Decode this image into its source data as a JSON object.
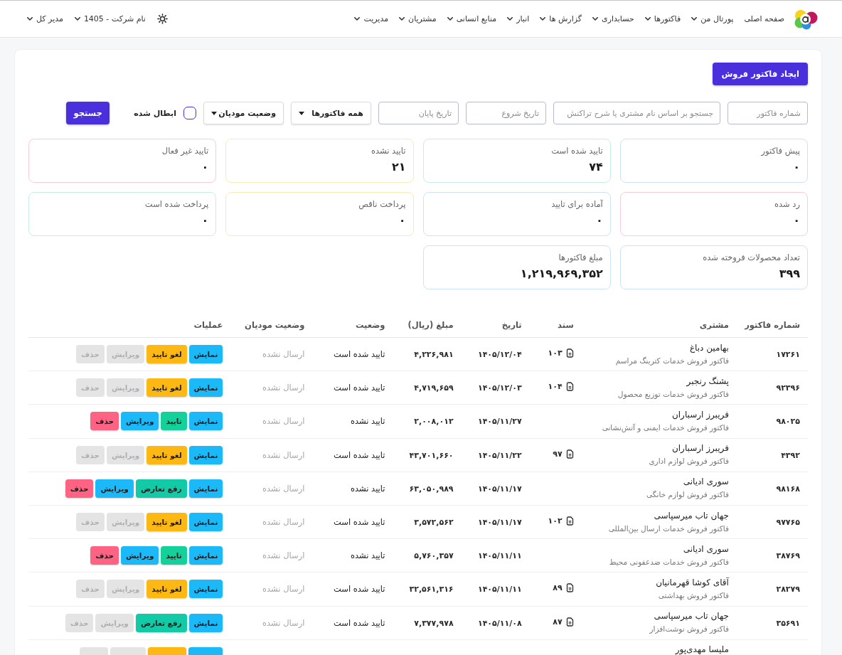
{
  "nav": {
    "items": [
      {
        "label": "صفحه اصلی",
        "dropdown": false
      },
      {
        "label": "پورتال من",
        "dropdown": true
      },
      {
        "label": "فاکتورها",
        "dropdown": true
      },
      {
        "label": "حسابداری",
        "dropdown": true
      },
      {
        "label": "گزارش ها",
        "dropdown": true
      },
      {
        "label": "انبار",
        "dropdown": true
      },
      {
        "label": "منابع انسانی",
        "dropdown": true
      },
      {
        "label": "مشتریان",
        "dropdown": true
      },
      {
        "label": "مدیریت",
        "dropdown": true
      }
    ],
    "company": "نام شرکت - 1405",
    "user": "مدیر کل"
  },
  "create_button": "ایجاد فاکتور فروش",
  "filters": {
    "fields": [
      {
        "kind": "text",
        "placeholder": "شماره فاکتور"
      },
      {
        "kind": "search",
        "placeholder": "جستجو بر اساس نام مشتری یا شرح تراکنش"
      },
      {
        "kind": "date",
        "placeholder": "تاریخ شروع"
      },
      {
        "kind": "date",
        "placeholder": "تاریخ پایان"
      },
      {
        "kind": "select",
        "value": "همه فاکتورها"
      },
      {
        "kind": "select",
        "value": "وضعیت مودیان"
      }
    ],
    "checkbox": {
      "label": "ابطال شده",
      "checked": false
    },
    "search_button": "جستجو"
  },
  "summary_cards": [
    {
      "label": "پیش فاکتور",
      "value": "۰",
      "color": "#cfe1f6"
    },
    {
      "label": "تایید شده است",
      "value": "۷۴",
      "color": "#c6efe4"
    },
    {
      "label": "تایید نشده",
      "value": "۲۱",
      "color": "#fbe9b7"
    },
    {
      "label": "تایید غیر فعال",
      "value": "۰",
      "color": "#f8cdd6"
    },
    {
      "label": "رد شده",
      "value": "۰",
      "color": "#f8cdd6"
    },
    {
      "label": "آماده برای تایید",
      "value": "۰",
      "color": "#cfe1f6"
    },
    {
      "label": "پرداخت ناقص",
      "value": "۰",
      "color": "#fbe9b7"
    },
    {
      "label": "پرداخت شده است",
      "value": "۰",
      "color": "#c6efe4"
    },
    {
      "label": "تعداد محصولات فروخته شده",
      "value": "۳۹۹",
      "color": "#cfe1f6"
    },
    {
      "label": "مبلغ فاکتورها",
      "value": "۱,۲۱۹,۹۶۹,۳۵۲",
      "color": "#cfe1f6"
    }
  ],
  "table": {
    "columns": [
      "شماره فاکتور",
      "مشتری",
      "سند",
      "تاریخ",
      "مبلغ (ریال)",
      "وضعیت",
      "وضعیت مودیان",
      "عملیات"
    ],
    "rows": [
      {
        "number": "۱۷۲۶۱",
        "customer": "بهامین دباغ",
        "description": "فاکتور فروش خدمات کترینگ مراسم",
        "document": "۱۰۳",
        "date": "۱۴۰۵/۱۲/۰۴",
        "amount": "۴,۲۲۶,۹۸۱",
        "status": "تایید شده است",
        "tax_status": "ارسال نشده",
        "actions": [
          {
            "kind": "view",
            "label": "نمایش",
            "disabled": false
          },
          {
            "kind": "unconfirm",
            "label": "لغو تایید",
            "disabled": false
          },
          {
            "kind": "edit",
            "label": "ویرایش",
            "disabled": true
          },
          {
            "kind": "delete",
            "label": "حذف",
            "disabled": true
          }
        ]
      },
      {
        "number": "۹۲۳۹۶",
        "customer": "پشنگ رنجبر",
        "description": "فاکتور فروش خدمات توزیع محصول",
        "document": "۱۰۴",
        "date": "۱۴۰۵/۱۲/۰۳",
        "amount": "۴,۷۱۹,۶۵۹",
        "status": "تایید شده است",
        "tax_status": "ارسال نشده",
        "actions": [
          {
            "kind": "view",
            "label": "نمایش",
            "disabled": false
          },
          {
            "kind": "unconfirm",
            "label": "لغو تایید",
            "disabled": false
          },
          {
            "kind": "edit",
            "label": "ویرایش",
            "disabled": true
          },
          {
            "kind": "delete",
            "label": "حذف",
            "disabled": true
          }
        ]
      },
      {
        "number": "۹۸۰۲۵",
        "customer": "فریبرز ارسباران",
        "description": "فاکتور فروش خدمات ایمنی و آتش‌نشانی",
        "date": "۱۴۰۵/۱۱/۲۷",
        "amount": "۲,۰۰۸,۰۱۲",
        "status": "تایید نشده",
        "tax_status": "ارسال نشده",
        "actions": [
          {
            "kind": "view",
            "label": "نمایش",
            "disabled": false
          },
          {
            "kind": "confirm",
            "label": "تایید",
            "disabled": false
          },
          {
            "kind": "edit",
            "label": "ویرایش",
            "disabled": false
          },
          {
            "kind": "delete",
            "label": "حذف",
            "disabled": false
          }
        ]
      },
      {
        "number": "۴۳۹۲",
        "customer": "فریبرز ارسباران",
        "description": "فاکتور فروش لوازم اداری",
        "document": "۹۷",
        "date": "۱۴۰۵/۱۱/۲۲",
        "amount": "۴۳,۷۰۱,۶۶۰",
        "status": "تایید شده است",
        "tax_status": "ارسال نشده",
        "actions": [
          {
            "kind": "view",
            "label": "نمایش",
            "disabled": false
          },
          {
            "kind": "unconfirm",
            "label": "لغو تایید",
            "disabled": false
          },
          {
            "kind": "edit",
            "label": "ویرایش",
            "disabled": true
          },
          {
            "kind": "delete",
            "label": "حذف",
            "disabled": true
          }
        ]
      },
      {
        "number": "۹۸۱۶۸",
        "customer": "سوری ادیانی",
        "description": "فاکتور فروش لوازم خانگی",
        "date": "۱۴۰۵/۱۱/۱۷",
        "amount": "۶۳,۰۵۰,۹۸۹",
        "status": "تایید نشده",
        "tax_status": "ارسال نشده",
        "actions": [
          {
            "kind": "view",
            "label": "نمایش",
            "disabled": false
          },
          {
            "kind": "resolve",
            "label": "رفع تعارض",
            "disabled": false
          },
          {
            "kind": "edit",
            "label": "ویرایش",
            "disabled": false
          },
          {
            "kind": "delete",
            "label": "حذف",
            "disabled": false
          }
        ]
      },
      {
        "number": "۹۷۷۶۵",
        "customer": "جهان تاب میرسپاسی",
        "description": "فاکتور فروش خدمات ارسال بین‌المللی",
        "document": "۱۰۲",
        "date": "۱۴۰۵/۱۱/۱۷",
        "amount": "۳,۵۷۲,۵۶۲",
        "status": "تایید شده است",
        "tax_status": "ارسال نشده",
        "actions": [
          {
            "kind": "view",
            "label": "نمایش",
            "disabled": false
          },
          {
            "kind": "unconfirm",
            "label": "لغو تایید",
            "disabled": false
          },
          {
            "kind": "edit",
            "label": "ویرایش",
            "disabled": true
          },
          {
            "kind": "delete",
            "label": "حذف",
            "disabled": true
          }
        ]
      },
      {
        "number": "۳۸۷۶۹",
        "customer": "سوری ادیانی",
        "description": "فاکتور فروش خدمات ضدعفونی محیط",
        "date": "۱۴۰۵/۱۱/۱۱",
        "amount": "۵,۷۶۰,۳۵۷",
        "status": "تایید نشده",
        "tax_status": "ارسال نشده",
        "actions": [
          {
            "kind": "view",
            "label": "نمایش",
            "disabled": false
          },
          {
            "kind": "confirm",
            "label": "تایید",
            "disabled": false
          },
          {
            "kind": "edit",
            "label": "ویرایش",
            "disabled": false
          },
          {
            "kind": "delete",
            "label": "حذف",
            "disabled": false
          }
        ]
      },
      {
        "number": "۲۸۲۷۹",
        "customer": "آقای کوشا قهرمانیان",
        "description": "فاکتور فروش بهداشتی",
        "document": "۸۹",
        "date": "۱۴۰۵/۱۱/۱۱",
        "amount": "۳۲,۵۶۱,۳۱۶",
        "status": "تایید شده است",
        "tax_status": "ارسال نشده",
        "actions": [
          {
            "kind": "view",
            "label": "نمایش",
            "disabled": false
          },
          {
            "kind": "unconfirm",
            "label": "لغو تایید",
            "disabled": false
          },
          {
            "kind": "edit",
            "label": "ویرایش",
            "disabled": true
          },
          {
            "kind": "delete",
            "label": "حذف",
            "disabled": true
          }
        ]
      },
      {
        "number": "۳۵۶۹۱",
        "customer": "جهان تاب میرسپاسی",
        "description": "فاکتور فروش نوشت‌افزار",
        "document": "۸۷",
        "date": "۱۴۰۵/۱۱/۰۸",
        "amount": "۷,۳۷۷,۹۷۸",
        "status": "تایید شده است",
        "tax_status": "ارسال نشده",
        "actions": [
          {
            "kind": "view",
            "label": "نمایش",
            "disabled": false
          },
          {
            "kind": "resolve",
            "label": "رفع تعارض",
            "disabled": false
          },
          {
            "kind": "edit",
            "label": "ویرایش",
            "disabled": true
          },
          {
            "kind": "delete",
            "label": "حذف",
            "disabled": true
          }
        ]
      },
      {
        "customer": "ملیسا مهدی‌پور",
        "actions": [
          {
            "kind": "view",
            "disabled": false
          },
          {
            "kind": "unconfirm",
            "disabled": false
          },
          {
            "kind": "edit",
            "disabled": true
          },
          {
            "kind": "delete",
            "disabled": true
          }
        ]
      }
    ]
  }
}
